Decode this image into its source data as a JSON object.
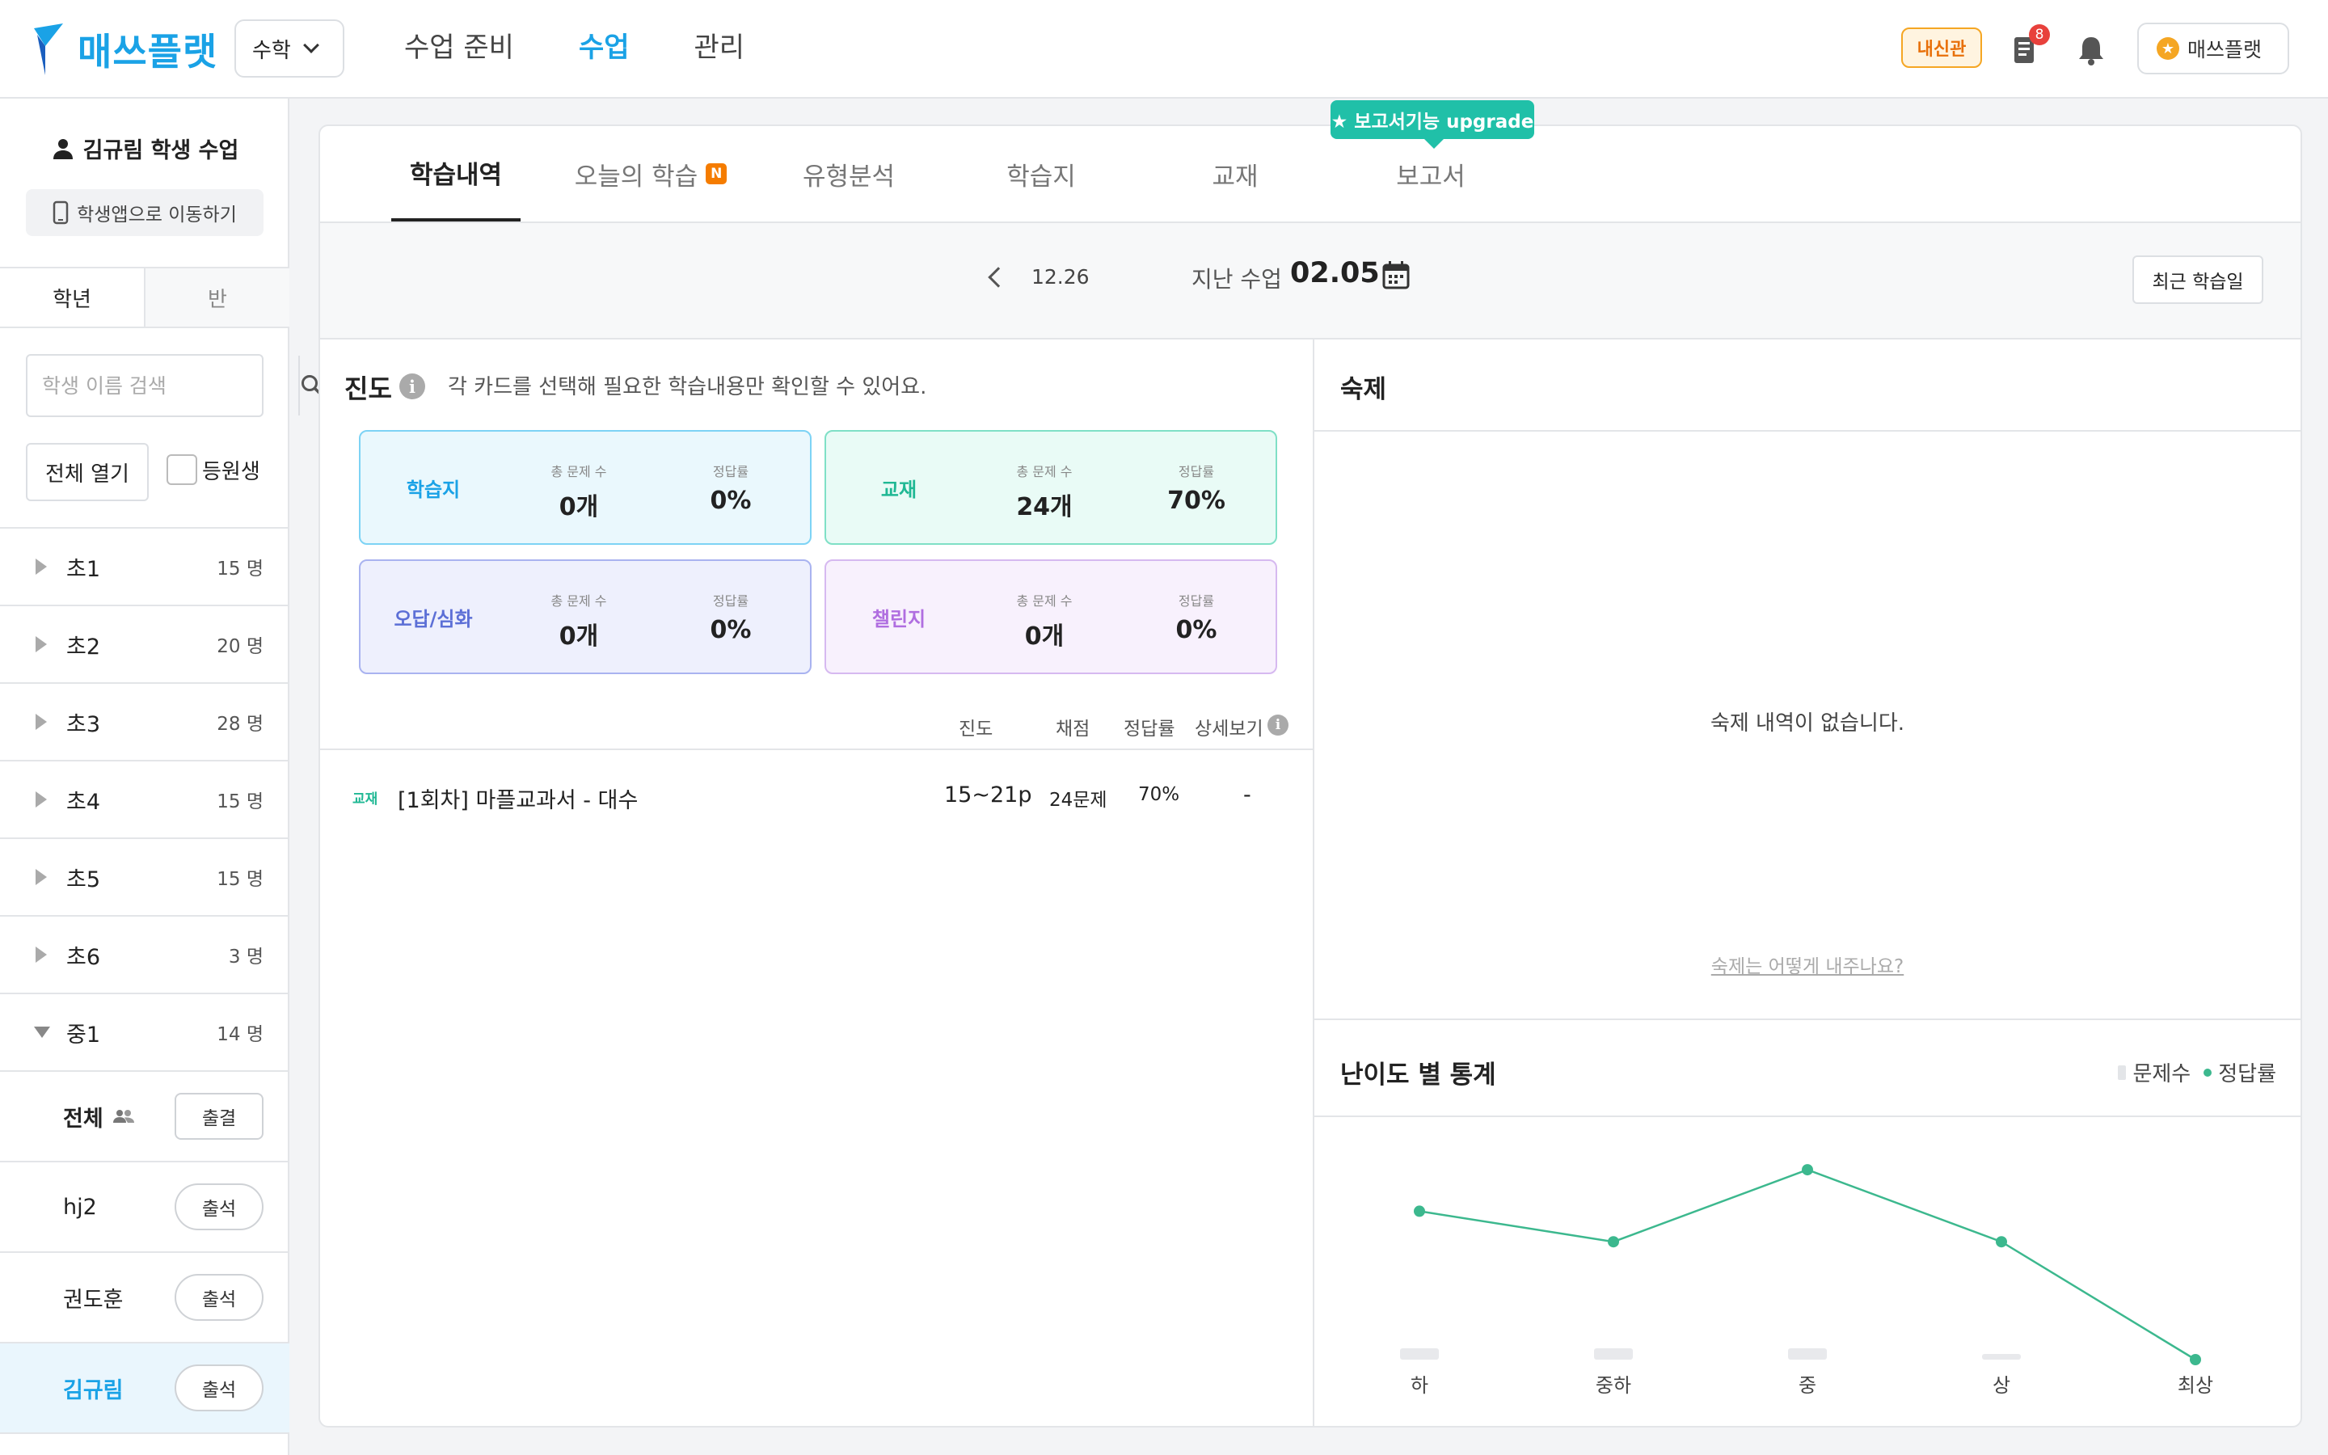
{
  "app": {
    "logo_text": "매쓰플랫"
  },
  "header": {
    "subject": "수학",
    "nav": [
      "수업 준비",
      "수업",
      "관리"
    ],
    "active_nav": 1,
    "school_badge": "내신관",
    "doc_badge_count": "8",
    "profile_label": "매쓰플랫",
    "accent_color": "#1aa2e6"
  },
  "sidebar": {
    "student_title": "김규림 학생 수업",
    "app_button": "학생앱으로 이동하기",
    "tabs": [
      "학년",
      "반"
    ],
    "search_placeholder": "학생 이름 검색",
    "open_all": "전체 열기",
    "enrolled_label": "등원생",
    "grades": [
      {
        "name": "초1",
        "count": "15 명"
      },
      {
        "name": "초2",
        "count": "20 명"
      },
      {
        "name": "초3",
        "count": "28 명"
      },
      {
        "name": "초4",
        "count": "15 명"
      },
      {
        "name": "초5",
        "count": "15 명"
      },
      {
        "name": "초6",
        "count": "3 명"
      },
      {
        "name": "중1",
        "count": "14 명"
      }
    ],
    "classes": [
      {
        "name": "전체",
        "button": "출결"
      },
      {
        "name": "hj2",
        "button": "출석"
      },
      {
        "name": "권도훈",
        "button": "출석"
      },
      {
        "name": "김규림",
        "button": "출석"
      }
    ]
  },
  "tabs": {
    "items": [
      "학습내역",
      "오늘의 학습",
      "유형분석",
      "학습지",
      "교재",
      "보고서"
    ],
    "new_badge": "N",
    "upgrade_tip": "★ 보고서기능 upgrade"
  },
  "date_bar": {
    "prev_date": "12.26",
    "last_label": "지난 수업",
    "date": "02.05",
    "recent_button": "최근 학습일"
  },
  "progress": {
    "title": "진도",
    "description": "각 카드를 선택해 필요한 학습내용만 확인할 수 있어요.",
    "stat_labels": {
      "total": "총 문제 수",
      "rate": "정답률"
    },
    "cards": [
      {
        "title": "학습지",
        "total": "0개",
        "rate": "0%"
      },
      {
        "title": "교재",
        "total": "24개",
        "rate": "70%"
      },
      {
        "title": "오답/심화",
        "total": "0개",
        "rate": "0%"
      },
      {
        "title": "챌린지",
        "total": "0개",
        "rate": "0%"
      }
    ],
    "table_headers": [
      "진도",
      "채점",
      "정답률",
      "상세보기"
    ],
    "rows": [
      {
        "tag": "교재",
        "title": "[1회차] 마플교과서 - 대수",
        "pages": "15~21p",
        "graded": "24문제",
        "rate": "70%",
        "detail": "-"
      }
    ]
  },
  "homework": {
    "title": "숙제",
    "empty": "숙제 내역이 없습니다.",
    "help_link": "숙제는 어떻게 내주나요?"
  },
  "stats": {
    "title": "난이도 별 통계",
    "legend": [
      "문제수",
      "정답률"
    ]
  },
  "chart_data": {
    "type": "line",
    "title": "난이도 별 통계",
    "categories": [
      "하",
      "중하",
      "중",
      "상",
      "최상"
    ],
    "series": [
      {
        "name": "정답률",
        "values": [
          68,
          54,
          87,
          54,
          0
        ]
      },
      {
        "name": "문제수",
        "values": [
          1,
          1,
          1,
          0.5,
          0
        ]
      }
    ],
    "ylim": [
      0,
      100
    ],
    "legend": "top-right",
    "colors": {
      "line": "#3cb88e",
      "bar": "#e8e9ec"
    }
  }
}
